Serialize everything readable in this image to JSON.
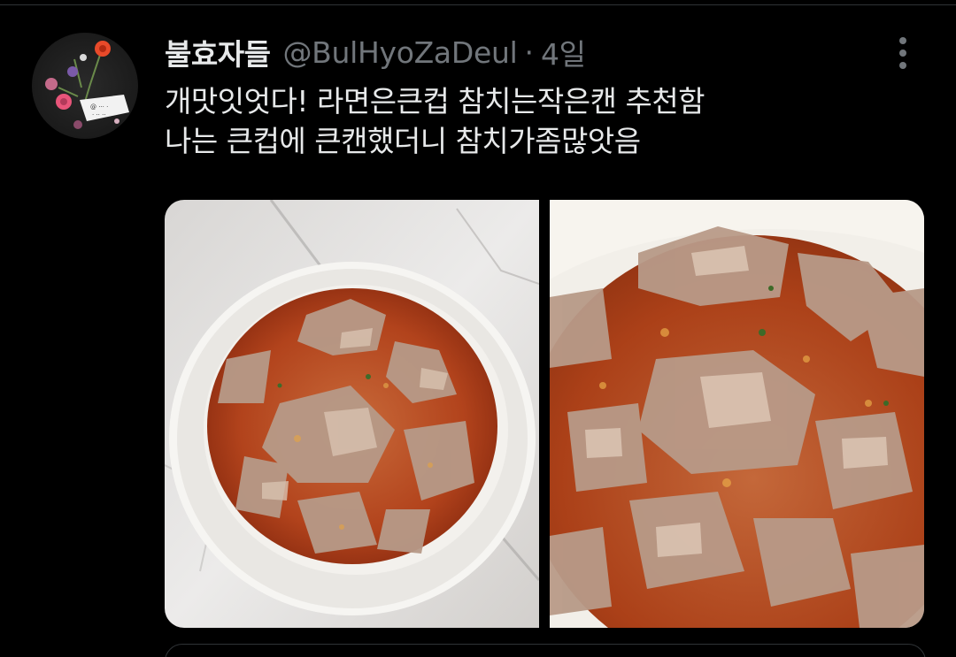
{
  "tweet": {
    "display_name": "불효자들",
    "handle": "@BulHyoZaDeul",
    "separator": "·",
    "time": "4일",
    "lines": [
      "개맛잇엇다! 라면은큰컵 참치는작은캔 추천함",
      "나는 큰컵에 큰캔했더니 참치가좀많앗음"
    ]
  },
  "icons": {
    "avatar": "avatar-image",
    "more": "more-options-icon"
  },
  "colors": {
    "background": "#000000",
    "primary_text": "#e7e9ea",
    "secondary_text": "#71767b",
    "divider": "#2f3336"
  }
}
